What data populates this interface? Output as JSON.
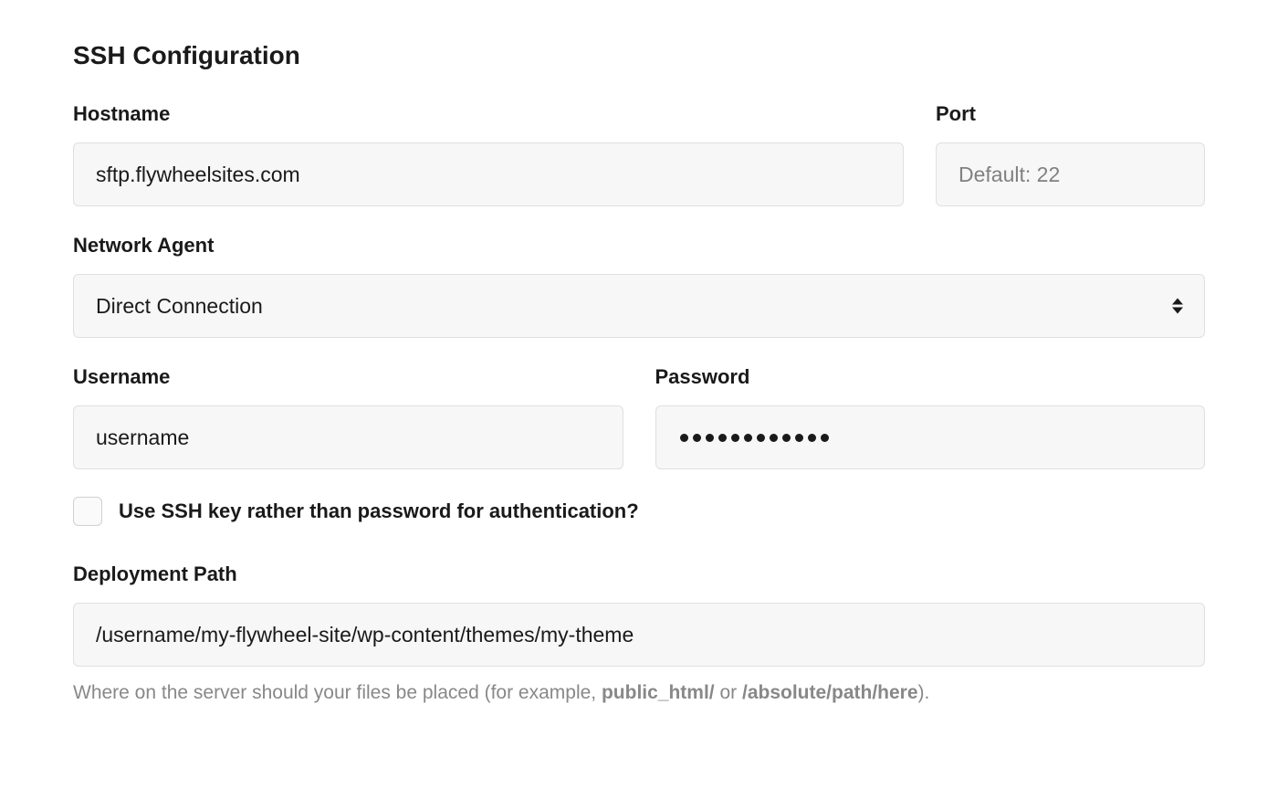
{
  "title": "SSH Configuration",
  "hostname": {
    "label": "Hostname",
    "value": "sftp.flywheelsites.com"
  },
  "port": {
    "label": "Port",
    "placeholder": "Default: 22",
    "value": ""
  },
  "networkAgent": {
    "label": "Network Agent",
    "selected": "Direct Connection"
  },
  "username": {
    "label": "Username",
    "value": "username"
  },
  "password": {
    "label": "Password",
    "dotCount": 12
  },
  "sshKey": {
    "label": "Use SSH key rather than password for authentication?",
    "checked": false
  },
  "deploymentPath": {
    "label": "Deployment Path",
    "value": "/username/my-flywheel-site/wp-content/themes/my-theme",
    "helpPrefix": "Where on the server should your files be placed (for example, ",
    "helpExample1": "public_html/",
    "helpMiddle": " or ",
    "helpExample2": "/absolute/path/here",
    "helpSuffix": ")."
  }
}
